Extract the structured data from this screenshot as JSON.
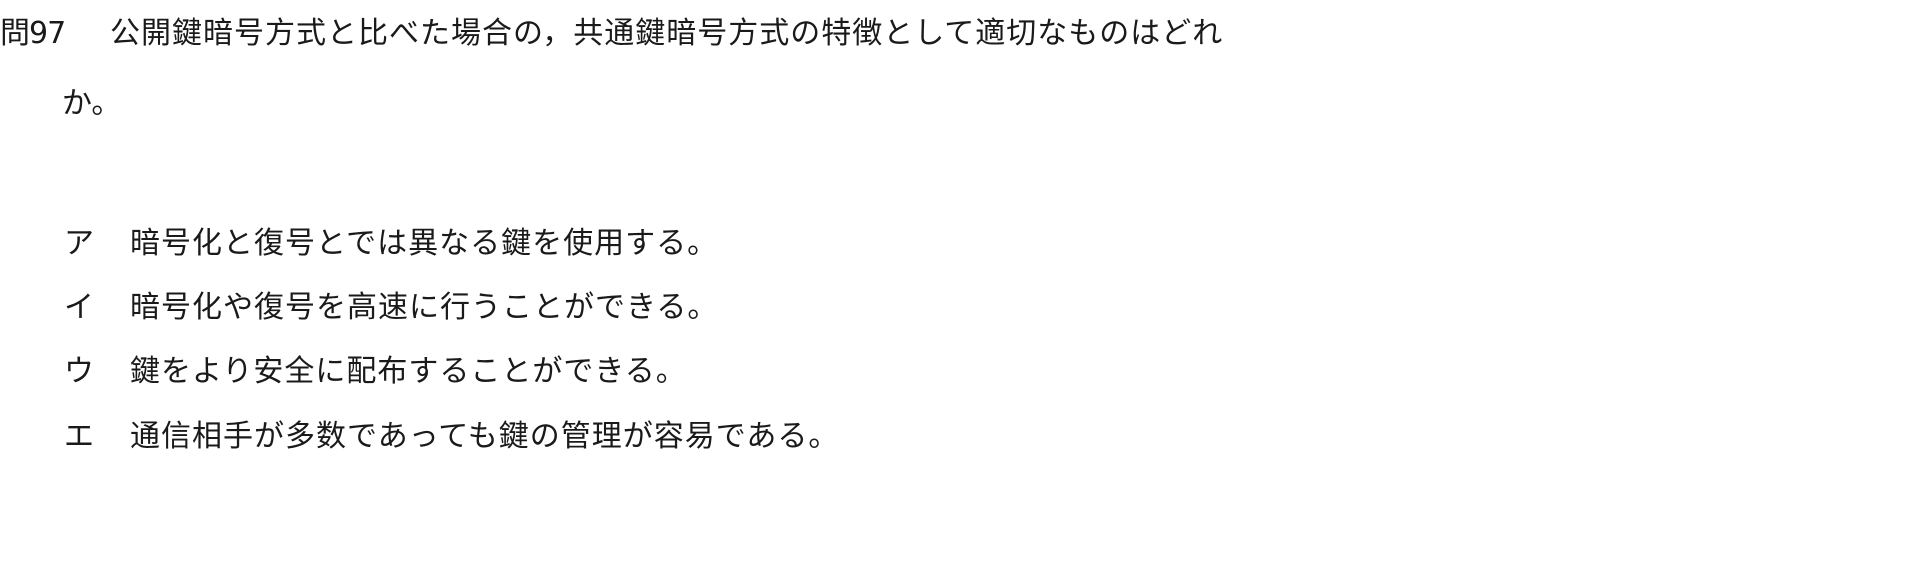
{
  "question": {
    "number": "問97",
    "line1": "公開鍵暗号方式と比べた場合の，共通鍵暗号方式の特徴として適切なものはどれ",
    "line2": "か。"
  },
  "options": [
    {
      "label": "ア",
      "text": "暗号化と復号とでは異なる鍵を使用する。"
    },
    {
      "label": "イ",
      "text": "暗号化や復号を高速に行うことができる。"
    },
    {
      "label": "ウ",
      "text": "鍵をより安全に配布することができる。"
    },
    {
      "label": "エ",
      "text": "通信相手が多数であっても鍵の管理が容易である。"
    }
  ]
}
